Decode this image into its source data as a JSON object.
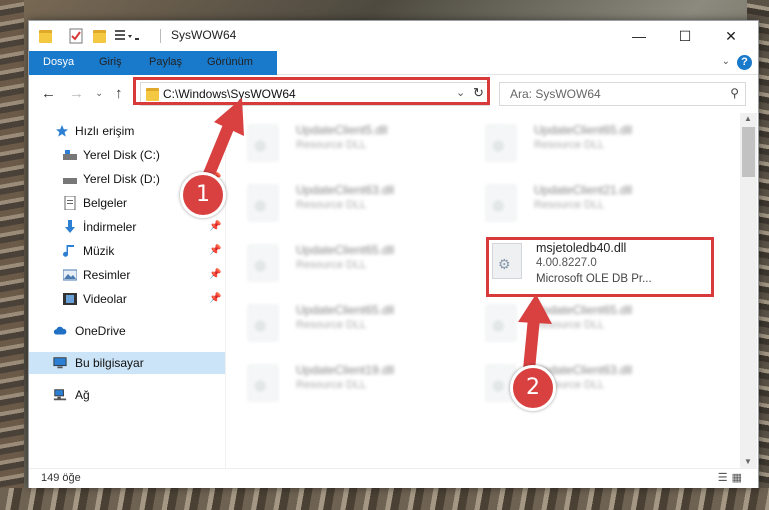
{
  "window": {
    "title": "SysWOW64",
    "controls": {
      "minimize": "—",
      "maximize": "☐",
      "close": "✕"
    }
  },
  "ribbon": {
    "tabs": [
      "Dosya",
      "Giriş",
      "Paylaş",
      "Görünüm"
    ],
    "help": "?"
  },
  "nav": {
    "address": "C:\\Windows\\SysWOW64",
    "search_placeholder": "Ara: SysWOW64"
  },
  "sidebar": {
    "items": [
      {
        "label": "Hızlı erişim",
        "icon": "star-icon"
      },
      {
        "label": "Yerel Disk (C:)",
        "icon": "drive-icon"
      },
      {
        "label": "Yerel Disk (D:)",
        "icon": "drive-icon"
      },
      {
        "label": "Belgeler",
        "icon": "documents-icon"
      },
      {
        "label": "İndirmeler",
        "icon": "download-icon"
      },
      {
        "label": "Müzik",
        "icon": "music-icon"
      },
      {
        "label": "Resimler",
        "icon": "pictures-icon"
      },
      {
        "label": "Videolar",
        "icon": "video-icon"
      },
      {
        "label": "OneDrive",
        "icon": "cloud-icon"
      },
      {
        "label": "Bu bilgisayar",
        "icon": "computer-icon"
      },
      {
        "label": "Ağ",
        "icon": "network-icon"
      }
    ]
  },
  "files": {
    "left": [
      {
        "name": "UpdateClient5.dll",
        "desc": "Resource DLL"
      },
      {
        "name": "UpdateClient63.dll",
        "desc": "Resource DLL"
      },
      {
        "name": "UpdateClient65.dll",
        "desc": "Resource DLL"
      },
      {
        "name": "UpdateClient65.dll",
        "desc": "Resource DLL"
      },
      {
        "name": "UpdateClient19.dll",
        "desc": "Resource DLL"
      }
    ],
    "right": [
      {
        "name": "UpdateClient65.dll",
        "desc": "Resource DLL"
      },
      {
        "name": "UpdateClient21.dll",
        "desc": "Resource DLL"
      },
      {
        "name": "UpdateClient65.dll",
        "desc": "Resource DLL"
      },
      {
        "name": "UpdateClient63.dll",
        "desc": "Resource DLL"
      }
    ],
    "highlighted": {
      "name": "msjetoledb40.dll",
      "version": "4.00.8227.0",
      "description": "Microsoft OLE DB Pr..."
    }
  },
  "status": {
    "count": "149 öğe"
  },
  "annotations": {
    "step1": "1",
    "step2": "2",
    "color": "#d94141"
  }
}
